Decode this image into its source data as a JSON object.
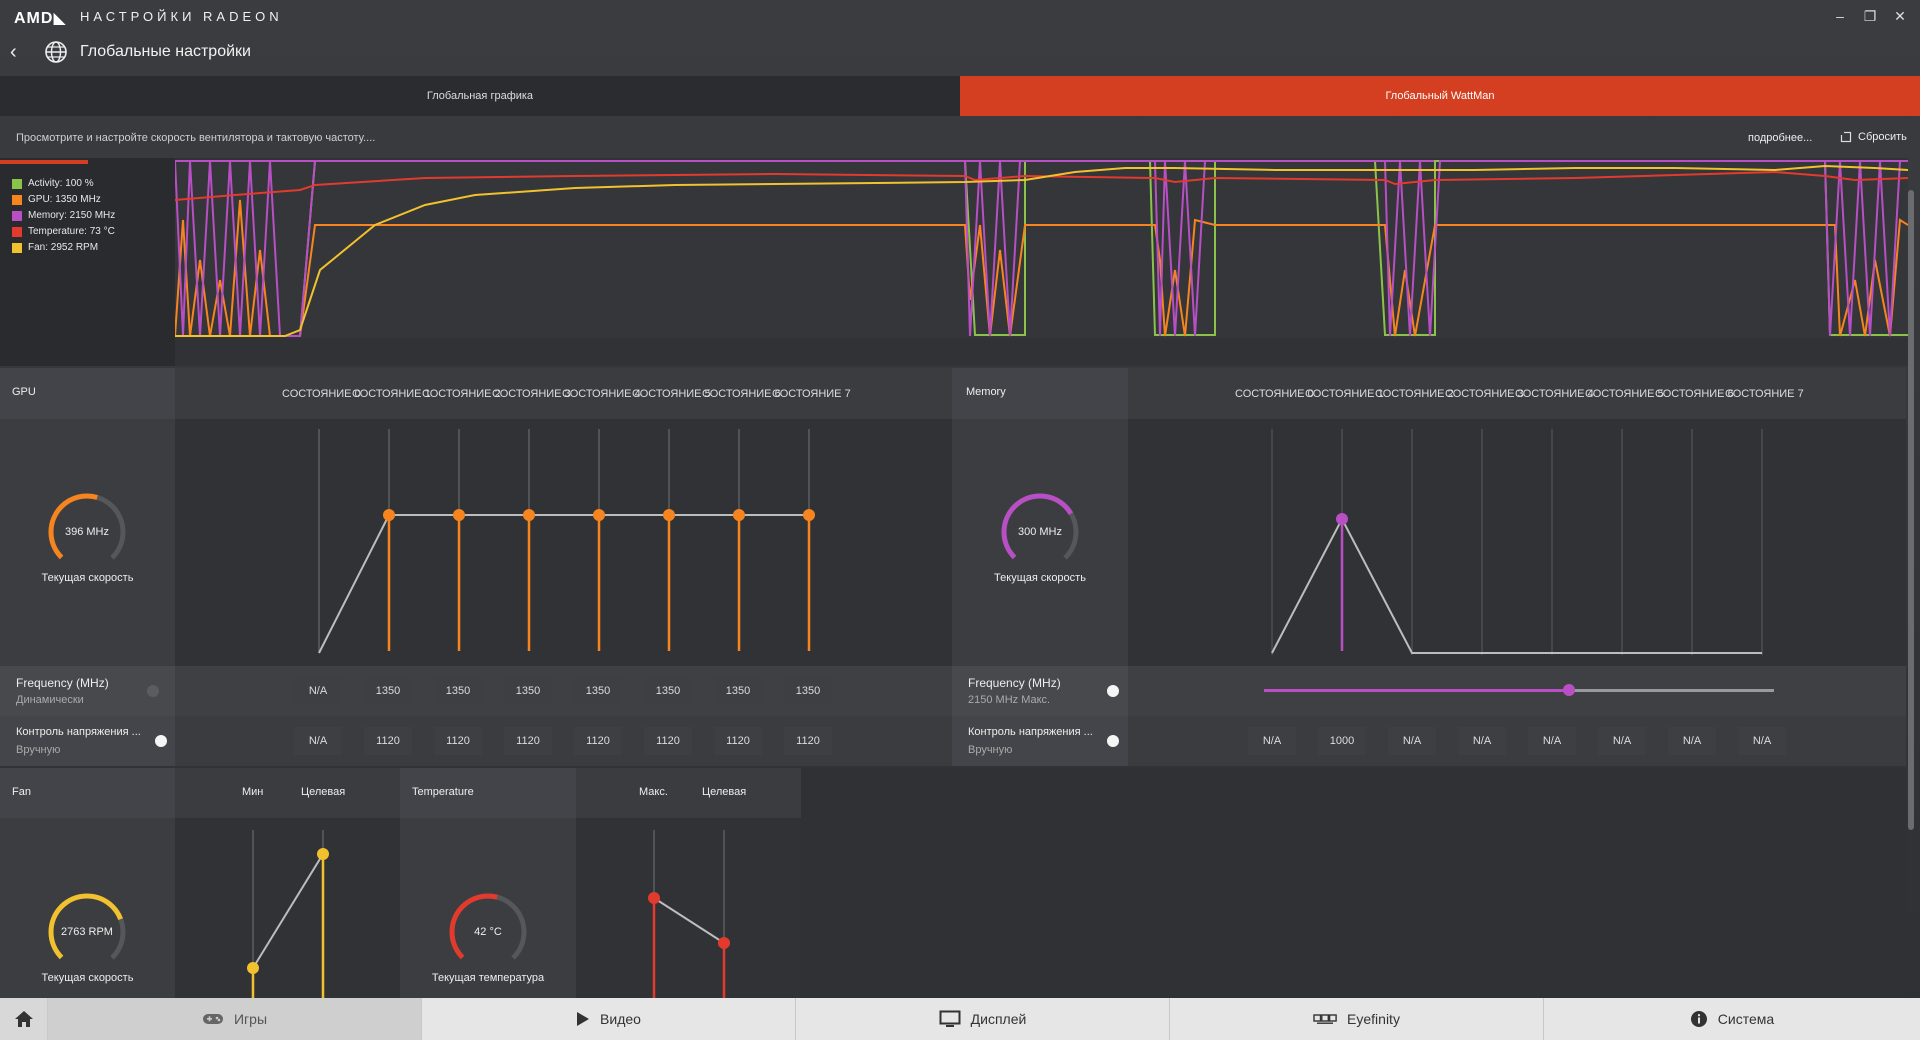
{
  "window": {
    "brand": "AMD◣",
    "title": "НАСТРОЙКИ RADEON",
    "controls": [
      "–",
      "❐",
      "✕"
    ]
  },
  "nav": {
    "back_icon": "chevron-left-icon",
    "page_icon": "globe-icon",
    "page_title": "Глобальные настройки"
  },
  "tabs": [
    {
      "label": "Глобальная графика",
      "active": false
    },
    {
      "label": "Глобальный WattMan",
      "active": true
    }
  ],
  "description": "Просмотрите и настройте скорость вентилятора и тактовую частоту....",
  "more_link": "подробнее...",
  "reset_label": "Сбросить",
  "legend": [
    {
      "label": "Activity: 100 %",
      "color": "#8bc34a"
    },
    {
      "label": "GPU: 1350 MHz",
      "color": "#f7851f"
    },
    {
      "label": "Memory: 2150 MHz",
      "color": "#b84fc4"
    },
    {
      "label": "Temperature: 73 °C",
      "color": "#e23b2e"
    },
    {
      "label": "Fan: 2952 RPM",
      "color": "#f2c12e"
    }
  ],
  "gpu": {
    "section": "GPU",
    "states": [
      "СОСТОЯНИЕ 0",
      "СОСТОЯНИЕ 1",
      "СОСТОЯНИЕ 2",
      "СОСТОЯНИЕ 3",
      "СОСТОЯНИЕ 4",
      "СОСТОЯНИЕ 5",
      "СОСТОЯНИЕ 6",
      "СОСТОЯНИЕ 7"
    ],
    "gauge_value": "396 MHz",
    "gauge_caption": "Текущая скорость",
    "gauge_fraction": 0.3,
    "frequency_label": "Frequency (MHz)",
    "frequency_sub": "Динамически",
    "frequency_values": [
      "N/A",
      "1350",
      "1350",
      "1350",
      "1350",
      "1350",
      "1350",
      "1350"
    ],
    "voltage_label": "Контроль напряжения ...",
    "voltage_sub": "Вручную",
    "voltage_values": [
      "N/A",
      "1120",
      "1120",
      "1120",
      "1120",
      "1120",
      "1120",
      "1120"
    ],
    "accent": "#f7851f"
  },
  "memory": {
    "section": "Memory",
    "states": [
      "СОСТОЯНИЕ 0",
      "СОСТОЯНИЕ 1",
      "СОСТОЯНИЕ 2",
      "СОСТОЯНИЕ 3",
      "СОСТОЯНИЕ 4",
      "СОСТОЯНИЕ 5",
      "СОСТОЯНИЕ 6",
      "СОСТОЯНИЕ 7"
    ],
    "gauge_value": "300 MHz",
    "gauge_caption": "Текущая скорость",
    "gauge_fraction": 0.72,
    "frequency_label": "Frequency (MHz)",
    "frequency_sub": "2150 MHz Макс.",
    "slider_fraction": 0.6,
    "voltage_label": "Контроль напряжения ...",
    "voltage_sub": "Вручную",
    "voltage_values": [
      "N/A",
      "1000",
      "N/A",
      "N/A",
      "N/A",
      "N/A",
      "N/A",
      "N/A"
    ],
    "accent": "#b84fc4"
  },
  "fan": {
    "section": "Fan",
    "min_label": "Мин",
    "target_label": "Целевая",
    "gauge_value": "2763 RPM",
    "gauge_caption": "Текущая скорость",
    "gauge_fraction": 0.75,
    "accent": "#f2c12e"
  },
  "temperature": {
    "section": "Temperature",
    "max_label": "Макс.",
    "target_label": "Целевая",
    "gauge_value": "42 °C",
    "gauge_caption": "Текущая температура",
    "gauge_fraction": 0.55,
    "accent": "#e23b2e"
  },
  "bottom_nav": [
    {
      "label": "",
      "icon": "home-icon"
    },
    {
      "label": "Игры",
      "icon": "gamepad-icon"
    },
    {
      "label": "Видео",
      "icon": "play-icon"
    },
    {
      "label": "Дисплей",
      "icon": "monitor-icon"
    },
    {
      "label": "Eyefinity",
      "icon": "eyefinity-icon"
    },
    {
      "label": "Система",
      "icon": "info-icon"
    }
  ]
}
